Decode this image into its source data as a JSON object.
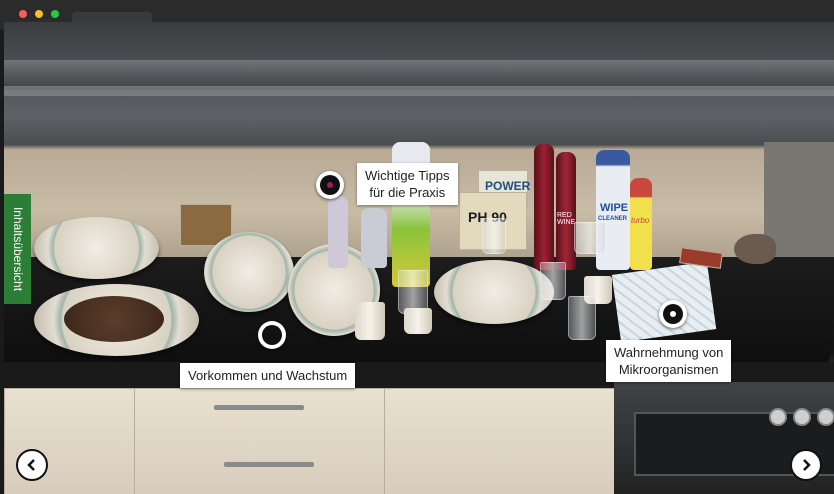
{
  "window": {
    "controls": [
      "close",
      "minimize",
      "maximize"
    ]
  },
  "hotspots": {
    "tips": {
      "label_line1": "Wichtige Tipps",
      "label_line2": "für die Praxis"
    },
    "growth": {
      "label": "Vorkommen und Wachstum"
    },
    "perception": {
      "label_line1": "Wahrnehmung von",
      "label_line2": "Mikroorganismen"
    }
  },
  "sidebar": {
    "tab_label": "Inhaltsübersicht"
  },
  "products": {
    "power_label": "POWER",
    "ph90_label": "PH 90",
    "wipe_label": "WIPE",
    "cleaner_label": "CLEANER",
    "turbo_label": "turbo",
    "wine_label": "RED WINE"
  },
  "nav": {
    "prev": "previous-icon",
    "next": "next-icon"
  },
  "colors": {
    "sidebar_green": "#2c7d35",
    "hotspot_core": "#9b1d5b"
  }
}
